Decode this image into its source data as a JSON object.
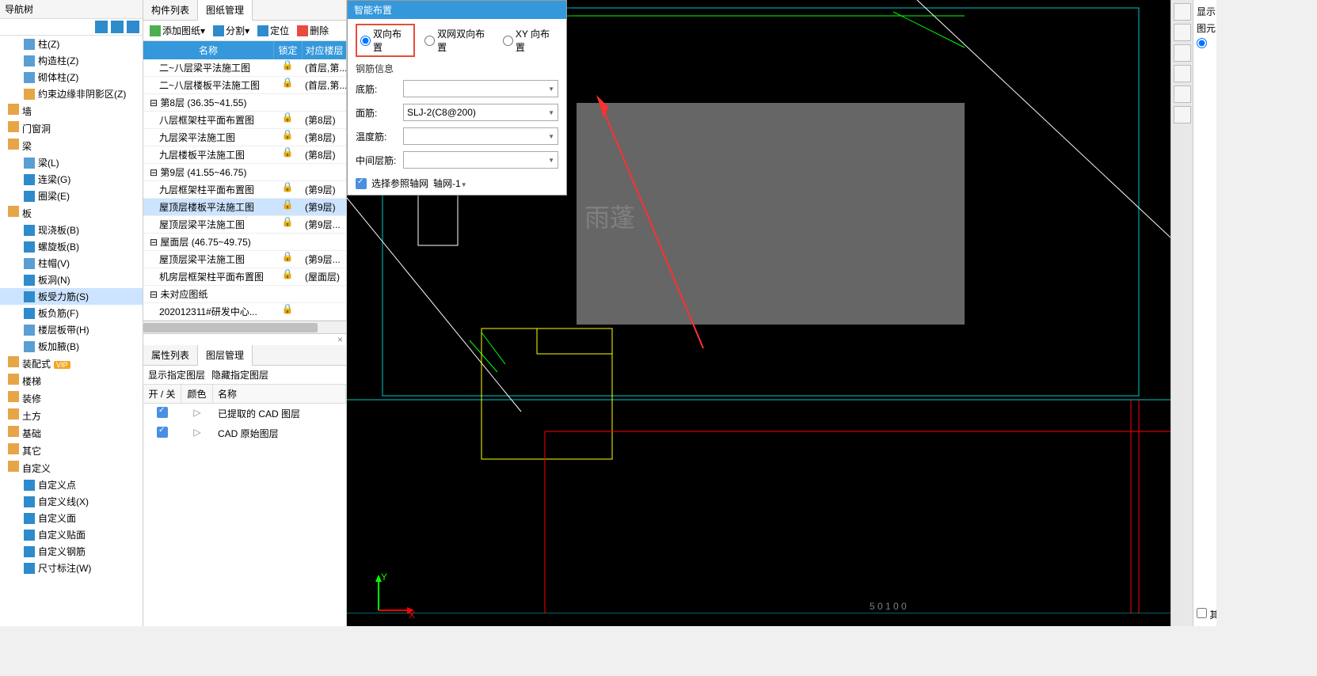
{
  "nav": {
    "title": "导航树",
    "items": [
      {
        "type": "item",
        "label": "柱(Z)",
        "icon": "ic-col"
      },
      {
        "type": "item",
        "label": "构造柱(Z)",
        "icon": "ic-col"
      },
      {
        "type": "item",
        "label": "砌体柱(Z)",
        "icon": "ic-col"
      },
      {
        "type": "item",
        "label": "约束边缘非阴影区(Z)",
        "icon": "ic-orange"
      },
      {
        "type": "group",
        "label": "墙"
      },
      {
        "type": "group",
        "label": "门窗洞"
      },
      {
        "type": "group",
        "label": "梁"
      },
      {
        "type": "item",
        "label": "梁(L)",
        "icon": "ic-col"
      },
      {
        "type": "item",
        "label": "连梁(G)",
        "icon": "ic-blue"
      },
      {
        "type": "item",
        "label": "圈梁(E)",
        "icon": "ic-blue"
      },
      {
        "type": "group",
        "label": "板"
      },
      {
        "type": "item",
        "label": "现浇板(B)",
        "icon": "ic-blue"
      },
      {
        "type": "item",
        "label": "螺旋板(B)",
        "icon": "ic-blue"
      },
      {
        "type": "item",
        "label": "柱帽(V)",
        "icon": "ic-col"
      },
      {
        "type": "item",
        "label": "板洞(N)",
        "icon": "ic-blue"
      },
      {
        "type": "item",
        "label": "板受力筋(S)",
        "icon": "ic-blue",
        "selected": true
      },
      {
        "type": "item",
        "label": "板负筋(F)",
        "icon": "ic-blue"
      },
      {
        "type": "item",
        "label": "楼层板带(H)",
        "icon": "ic-col"
      },
      {
        "type": "item",
        "label": "板加腋(B)",
        "icon": "ic-col"
      },
      {
        "type": "group",
        "label": "装配式",
        "vip": "VIP"
      },
      {
        "type": "group",
        "label": "楼梯"
      },
      {
        "type": "group",
        "label": "装修"
      },
      {
        "type": "group",
        "label": "土方"
      },
      {
        "type": "group",
        "label": "基础"
      },
      {
        "type": "group",
        "label": "其它"
      },
      {
        "type": "group",
        "label": "自定义"
      },
      {
        "type": "item",
        "label": "自定义点",
        "icon": "ic-blue"
      },
      {
        "type": "item",
        "label": "自定义线(X)",
        "icon": "ic-blue"
      },
      {
        "type": "item",
        "label": "自定义面",
        "icon": "ic-blue"
      },
      {
        "type": "item",
        "label": "自定义贴面",
        "icon": "ic-blue"
      },
      {
        "type": "item",
        "label": "自定义钢筋",
        "icon": "ic-blue"
      },
      {
        "type": "item",
        "label": "尺寸标注(W)",
        "icon": "ic-blue"
      }
    ]
  },
  "mid": {
    "tabs": [
      "构件列表",
      "图纸管理"
    ],
    "active_tab": 1,
    "toolbar": {
      "add": "添加图纸",
      "split": "分割",
      "locate": "定位",
      "delete": "删除"
    },
    "dwg_head": {
      "name": "名称",
      "lock": "锁定",
      "floor": "对应楼层"
    },
    "dwg_rows": [
      {
        "name": "二~八层梁平法施工图",
        "lock": true,
        "floor": "(首层,第..."
      },
      {
        "name": "二~八层楼板平法施工图",
        "lock": true,
        "floor": "(首层,第..."
      },
      {
        "name": "第8层 (36.35~41.55)",
        "group": true
      },
      {
        "name": "八层框架柱平面布置图",
        "lock": true,
        "floor": "(第8层)"
      },
      {
        "name": "九层梁平法施工图",
        "lock": true,
        "floor": "(第8层)"
      },
      {
        "name": "九层楼板平法施工图",
        "lock": true,
        "floor": "(第8层)"
      },
      {
        "name": "第9层 (41.55~46.75)",
        "group": true
      },
      {
        "name": "九层框架柱平面布置图",
        "lock": true,
        "floor": "(第9层)"
      },
      {
        "name": "屋顶层楼板平法施工图",
        "lock": true,
        "floor": "(第9层)",
        "selected": true
      },
      {
        "name": "屋顶层梁平法施工图",
        "lock": true,
        "floor": "(第9层..."
      },
      {
        "name": "屋面层 (46.75~49.75)",
        "group": true
      },
      {
        "name": "屋顶层梁平法施工图",
        "lock": true,
        "floor": "(第9层..."
      },
      {
        "name": "机房层框架柱平面布置图",
        "lock": true,
        "floor": "(屋面层)"
      },
      {
        "name": "未对应图纸",
        "group": true
      },
      {
        "name": "202012311#研发中心...",
        "lock": true,
        "floor": ""
      }
    ]
  },
  "prop": {
    "tabs": [
      "属性列表",
      "图层管理"
    ],
    "active_tab": 1,
    "instr": {
      "show": "显示指定图层",
      "hide": "隐藏指定图层"
    },
    "head": {
      "onoff": "开 / 关",
      "color": "颜色",
      "name": "名称"
    },
    "rows": [
      {
        "on": true,
        "name": "已提取的 CAD 图层"
      },
      {
        "on": true,
        "name": "CAD 原始图层"
      }
    ]
  },
  "dialog": {
    "title": "智能布置",
    "radios": {
      "r1": "双向布置",
      "r2": "双网双向布置",
      "r3": "XY 向布置"
    },
    "group_title": "钢筋信息",
    "fields": {
      "bottom": {
        "label": "底筋:",
        "value": ""
      },
      "top": {
        "label": "面筋:",
        "value": "SLJ-2(C8@200)"
      },
      "temp": {
        "label": "温度筋:",
        "value": ""
      },
      "mid": {
        "label": "中间层筋:",
        "value": ""
      }
    },
    "ref": {
      "check_label": "选择参照轴网",
      "value": "轴网-1"
    }
  },
  "canvas": {
    "annotation": "雨蓬",
    "axis_y": "Y",
    "axis_x": "X"
  },
  "far_right": {
    "title": "显示",
    "sub": "图元",
    "opt": "其"
  }
}
